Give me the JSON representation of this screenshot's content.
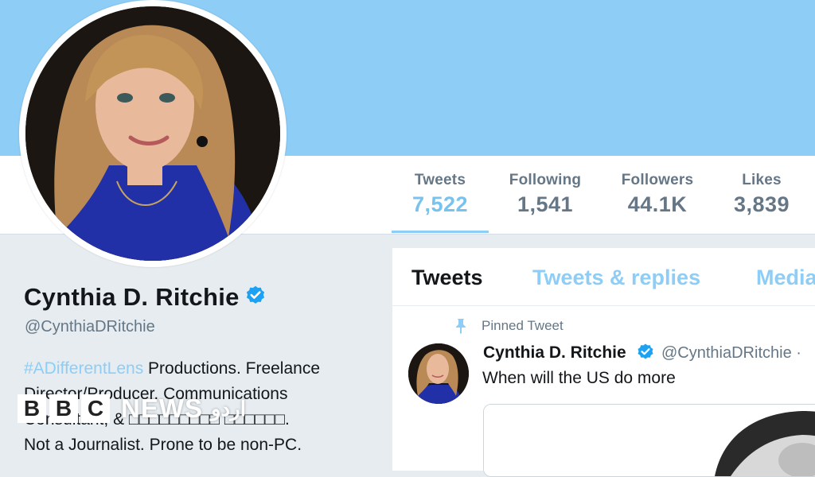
{
  "colors": {
    "banner": "#8ecdf6",
    "accent": "#78c2ee",
    "verified": "#1da1f2",
    "text_primary": "#14171a",
    "text_secondary": "#657786"
  },
  "stats": [
    {
      "label": "Tweets",
      "value": "7,522",
      "active": true
    },
    {
      "label": "Following",
      "value": "1,541",
      "active": false
    },
    {
      "label": "Followers",
      "value": "44.1K",
      "active": false
    },
    {
      "label": "Likes",
      "value": "3,839",
      "active": false
    }
  ],
  "profile": {
    "name": "Cynthia D. Ritchie",
    "handle": "@CynthiaDRitchie",
    "verified_icon": "verified-badge-icon",
    "bio": {
      "hashtag": "#ADifferentLens",
      "line1_rest": " Productions. Freelance",
      "line2": "Director/Producer. Communications",
      "line3": "Consultant, & □□□□□□□□□ □□□□□□.",
      "line4": "Not a Journalist. Prone to be non-PC."
    }
  },
  "feed": {
    "tabs": [
      {
        "label": "Tweets",
        "active": true
      },
      {
        "label": "Tweets & replies",
        "active": false
      },
      {
        "label": "Media",
        "active": false
      }
    ],
    "pinned_label": "Pinned Tweet",
    "pin_icon": "pin-icon",
    "tweet": {
      "name": "Cynthia D. Ritchie",
      "handle": "@CynthiaDRitchie ·",
      "text": "When will the US do more"
    }
  },
  "watermark": {
    "letters": [
      "B",
      "B",
      "C"
    ],
    "news": "NEWS",
    "urdu": "اردو"
  }
}
